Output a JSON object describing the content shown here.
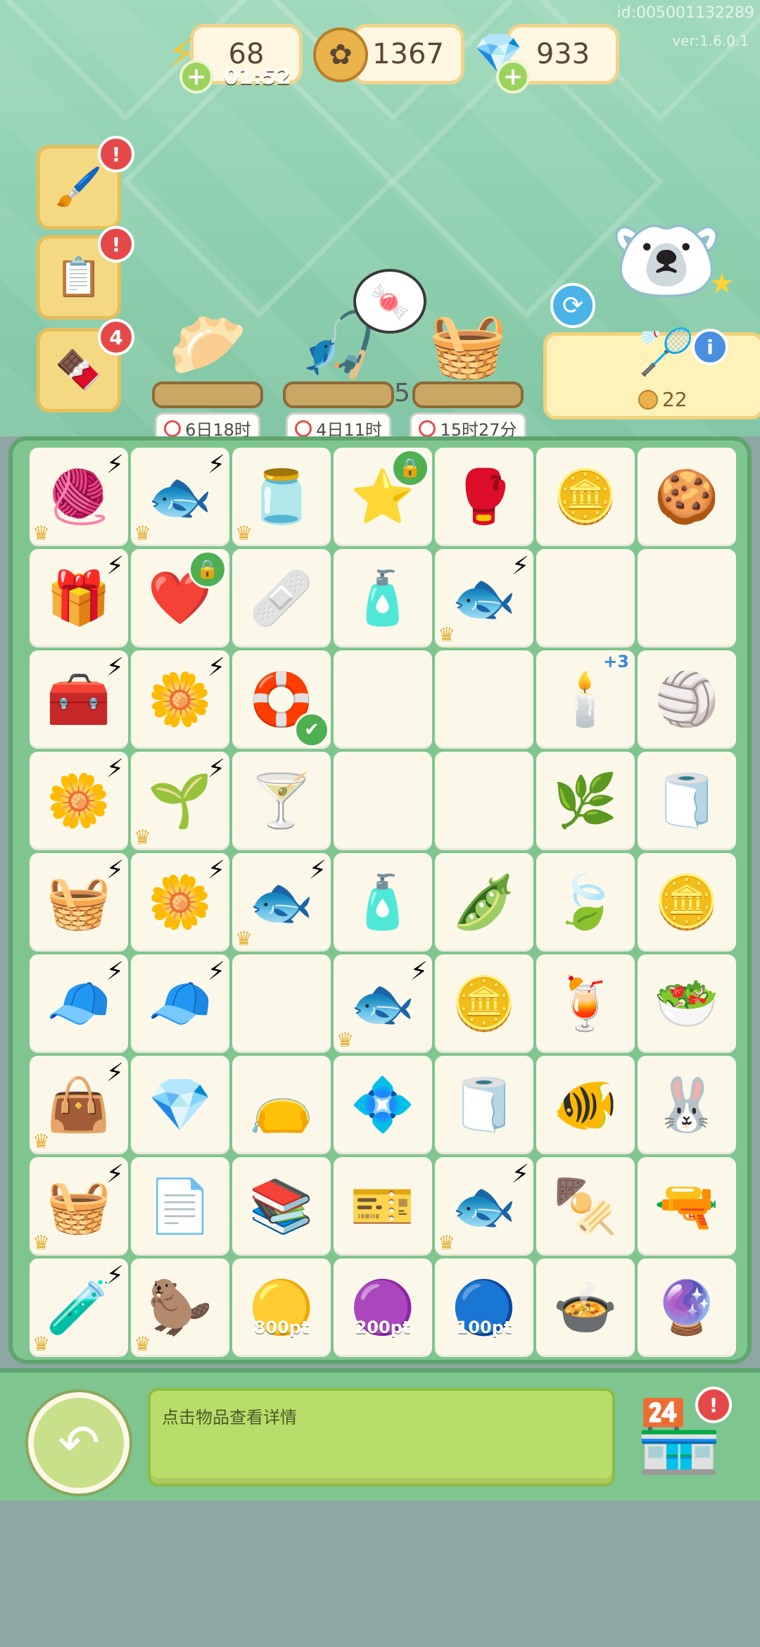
{
  "overlay": {
    "id_text": "id:005001132289",
    "version_text": "ver:1.6.0.1"
  },
  "resources": {
    "energy": {
      "value": "68",
      "timer": "01:52",
      "icon": "lightning-icon"
    },
    "coins": {
      "value": "1367",
      "icon": "coin-icon"
    },
    "gems": {
      "value": "933",
      "icon": "crystal-icon"
    }
  },
  "side_buttons": [
    {
      "name": "paint-task-button",
      "icon": "🖌️",
      "badge": "!"
    },
    {
      "name": "clipboard-task-button",
      "icon": "📋",
      "badge": "!"
    },
    {
      "name": "chocolate-event-button",
      "icon": "🍫",
      "badge": "4"
    }
  ],
  "producers": [
    {
      "name": "dumpling-producer",
      "icon": "🥟",
      "time": "6日18时"
    },
    {
      "name": "fishing-rod-producer",
      "icon": "🎣",
      "time": "4日11时"
    },
    {
      "name": "basket-producer",
      "icon": "🧺",
      "time": "15时27分"
    }
  ],
  "producer_count": "5",
  "order": {
    "item_icon": "🏸",
    "cost": "22"
  },
  "board": [
    [
      {
        "i": "🧶",
        "b": 1,
        "c": 1
      },
      {
        "i": "🐟",
        "b": 1,
        "c": 1
      },
      {
        "i": "🫙",
        "c": 1
      },
      {
        "i": "⭐",
        "lock": 1
      },
      {
        "i": "🥊"
      },
      {
        "i": "🪙"
      },
      {
        "i": "🍪"
      }
    ],
    [
      {
        "i": "🎁",
        "b": 1
      },
      {
        "i": "❤️",
        "lock": 1
      },
      {
        "i": "🩹"
      },
      {
        "i": "🧴"
      },
      {
        "i": "🐟",
        "b": 1,
        "c": 1
      },
      {
        "i": ""
      },
      {
        "i": ""
      }
    ],
    [
      {
        "i": "🧰",
        "b": 1
      },
      {
        "i": "🌼",
        "b": 1
      },
      {
        "i": "🛟",
        "check": 1
      },
      {
        "i": ""
      },
      {
        "i": ""
      },
      {
        "i": "🕯️",
        "bonus": "+3"
      },
      {
        "i": "🏐"
      }
    ],
    [
      {
        "i": "🌼",
        "b": 1
      },
      {
        "i": "🌱",
        "b": 1,
        "c": 1
      },
      {
        "i": "🍸"
      },
      {
        "i": ""
      },
      {
        "i": ""
      },
      {
        "i": "🌿"
      },
      {
        "i": "🧻"
      }
    ],
    [
      {
        "i": "🧺",
        "b": 1
      },
      {
        "i": "🌼",
        "b": 1
      },
      {
        "i": "🐟",
        "b": 1,
        "c": 1
      },
      {
        "i": "🧴"
      },
      {
        "i": "🫛"
      },
      {
        "i": "🍃"
      },
      {
        "i": "🪙"
      }
    ],
    [
      {
        "i": "🧢",
        "b": 1
      },
      {
        "i": "🧢",
        "b": 1
      },
      {
        "i": ""
      },
      {
        "i": "🐟",
        "b": 1,
        "c": 1
      },
      {
        "i": "🪙"
      },
      {
        "i": "🍹"
      },
      {
        "i": "🥗"
      }
    ],
    [
      {
        "i": "👜",
        "b": 1,
        "c": 1
      },
      {
        "i": "💎"
      },
      {
        "i": "👝"
      },
      {
        "i": "💠"
      },
      {
        "i": "🧻"
      },
      {
        "i": "🐠"
      },
      {
        "i": "🐰"
      }
    ],
    [
      {
        "i": "🧺",
        "b": 1,
        "c": 1
      },
      {
        "i": "📄"
      },
      {
        "i": "📚"
      },
      {
        "i": "🎫"
      },
      {
        "i": "🐟",
        "b": 1,
        "c": 1
      },
      {
        "i": "🍢"
      },
      {
        "i": "🔫"
      }
    ],
    [
      {
        "i": "🧪",
        "b": 1,
        "c": 1
      },
      {
        "i": "🦫",
        "c": 1
      },
      {
        "i": "🟡",
        "lbl": "800pt"
      },
      {
        "i": "🟣",
        "lbl": "200pt"
      },
      {
        "i": "🔵",
        "lbl": "100pt"
      },
      {
        "i": "🍲"
      },
      {
        "i": "🔮"
      }
    ]
  ],
  "hint_text": "点击物品查看详情",
  "shop": {
    "icon": "🏪",
    "badge": "!"
  }
}
